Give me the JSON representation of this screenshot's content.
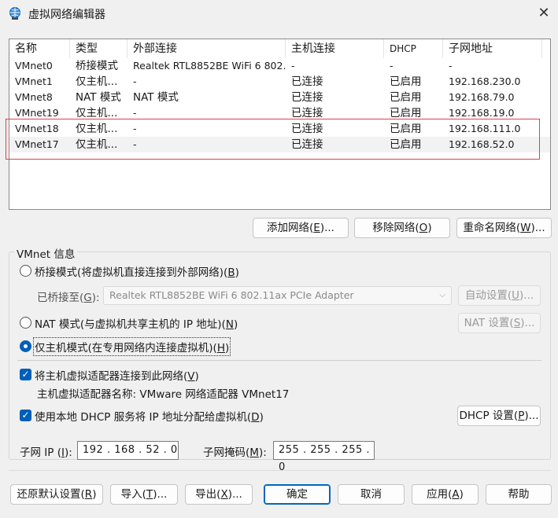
{
  "window": {
    "title": "虚拟网络编辑器",
    "close_glyph": "✕"
  },
  "table": {
    "columns": [
      "名称",
      "类型",
      "外部连接",
      "主机连接",
      "DHCP",
      "子网地址"
    ],
    "rows": [
      [
        "VMnet0",
        "桥接模式",
        "Realtek RTL8852BE WiFi 6 802....",
        "-",
        "-",
        "-"
      ],
      [
        "VMnet1",
        "仅主机...",
        "-",
        "已连接",
        "已启用",
        "192.168.230.0"
      ],
      [
        "VMnet8",
        "NAT 模式",
        "NAT 模式",
        "已连接",
        "已启用",
        "192.168.79.0"
      ],
      [
        "VMnet19",
        "仅主机...",
        "-",
        "已连接",
        "已启用",
        "192.168.19.0"
      ],
      [
        "VMnet18",
        "仅主机...",
        "-",
        "已连接",
        "已启用",
        "192.168.111.0"
      ],
      [
        "VMnet17",
        "仅主机...",
        "-",
        "已连接",
        "已启用",
        "192.168.52.0"
      ]
    ]
  },
  "network_buttons": {
    "add": {
      "text": "添加网络(",
      "key": "E",
      "tail": ")..."
    },
    "remove": {
      "text": "移除网络(",
      "key": "O",
      "tail": ")"
    },
    "rename": {
      "text": "重命名网络(",
      "key": "W",
      "tail": ")..."
    }
  },
  "vmnet_info": {
    "group_label": "VMnet 信息",
    "bridge": {
      "text": "桥接模式(将虚拟机直接连接到外部网络)(",
      "key": "B",
      "tail": ")"
    },
    "bridged_to": {
      "text": "已桥接至(",
      "key": "G",
      "tail": "):"
    },
    "bridged_adapter": "Realtek RTL8852BE WiFi 6 802.11ax PCIe Adapter",
    "auto_settings": {
      "text": "自动设置(",
      "key": "U",
      "tail": ")..."
    },
    "nat": {
      "text": "NAT 模式(与虚拟机共享主机的 IP 地址)(",
      "key": "N",
      "tail": ")"
    },
    "nat_settings": {
      "text": "NAT 设置(",
      "key": "S",
      "tail": ")..."
    },
    "host_only": {
      "text": "仅主机模式(在专用网络内连接虚拟机)(",
      "key": "H",
      "tail": ")"
    },
    "connect_adapter": {
      "text": "将主机虚拟适配器连接到此网络(",
      "key": "V",
      "tail": ")"
    },
    "adapter_name_label": "主机虚拟适配器名称: VMware 网络适配器 VMnet17",
    "use_dhcp": {
      "text": "使用本地 DHCP 服务将 IP 地址分配给虚拟机(",
      "key": "D",
      "tail": ")"
    },
    "dhcp_settings": {
      "text": "DHCP 设置(",
      "key": "P",
      "tail": ")..."
    },
    "subnet_ip_label": {
      "text": "子网 IP (",
      "key": "I",
      "tail": "):"
    },
    "subnet_ip": "192 . 168 . 52 .  0",
    "subnet_mask_label": {
      "text": "子网掩码(",
      "key": "M",
      "tail": "):"
    },
    "subnet_mask": "255 . 255 . 255 .  0"
  },
  "footer": {
    "restore": {
      "text": "还原默认设置(",
      "key": "R",
      "tail": ")"
    },
    "import": {
      "text": "导入(",
      "key": "T",
      "tail": ")..."
    },
    "export": {
      "text": "导出(",
      "key": "X",
      "tail": ")..."
    },
    "ok": "确定",
    "cancel": "取消",
    "apply": {
      "text": "应用(",
      "key": "A",
      "tail": ")"
    },
    "help": "帮助"
  },
  "colors": {
    "accent": "#005fb8",
    "highlight_border": "#e0414a"
  }
}
